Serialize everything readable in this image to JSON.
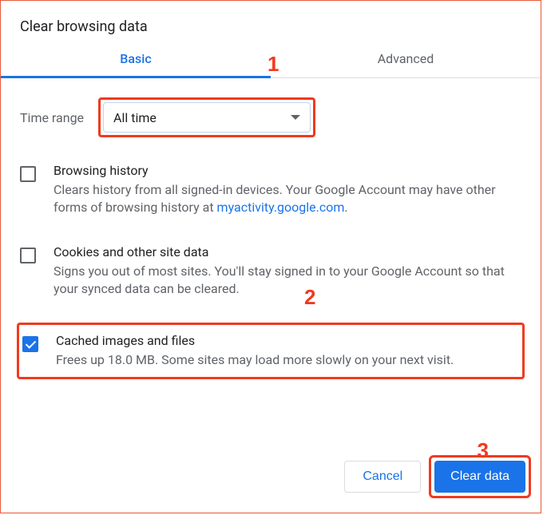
{
  "dialog": {
    "title": "Clear browsing data"
  },
  "tabs": {
    "basic": "Basic",
    "advanced": "Advanced"
  },
  "timerange": {
    "label": "Time range",
    "value": "All time"
  },
  "options": {
    "browsing": {
      "title": "Browsing history",
      "desc_pre": "Clears history from all signed-in devices. Your Google Account may have other forms of browsing history at ",
      "link": "myactivity.google.com",
      "desc_post": ".",
      "checked": false
    },
    "cookies": {
      "title": "Cookies and other site data",
      "desc": "Signs you out of most sites. You'll stay signed in to your Google Account so that your synced data can be cleared.",
      "checked": false
    },
    "cache": {
      "title": "Cached images and files",
      "desc": "Frees up 18.0 MB. Some sites may load more slowly on your next visit.",
      "checked": true
    }
  },
  "buttons": {
    "cancel": "Cancel",
    "clear": "Clear data"
  },
  "annotations": {
    "a1": "1",
    "a2": "2",
    "a3": "3"
  }
}
